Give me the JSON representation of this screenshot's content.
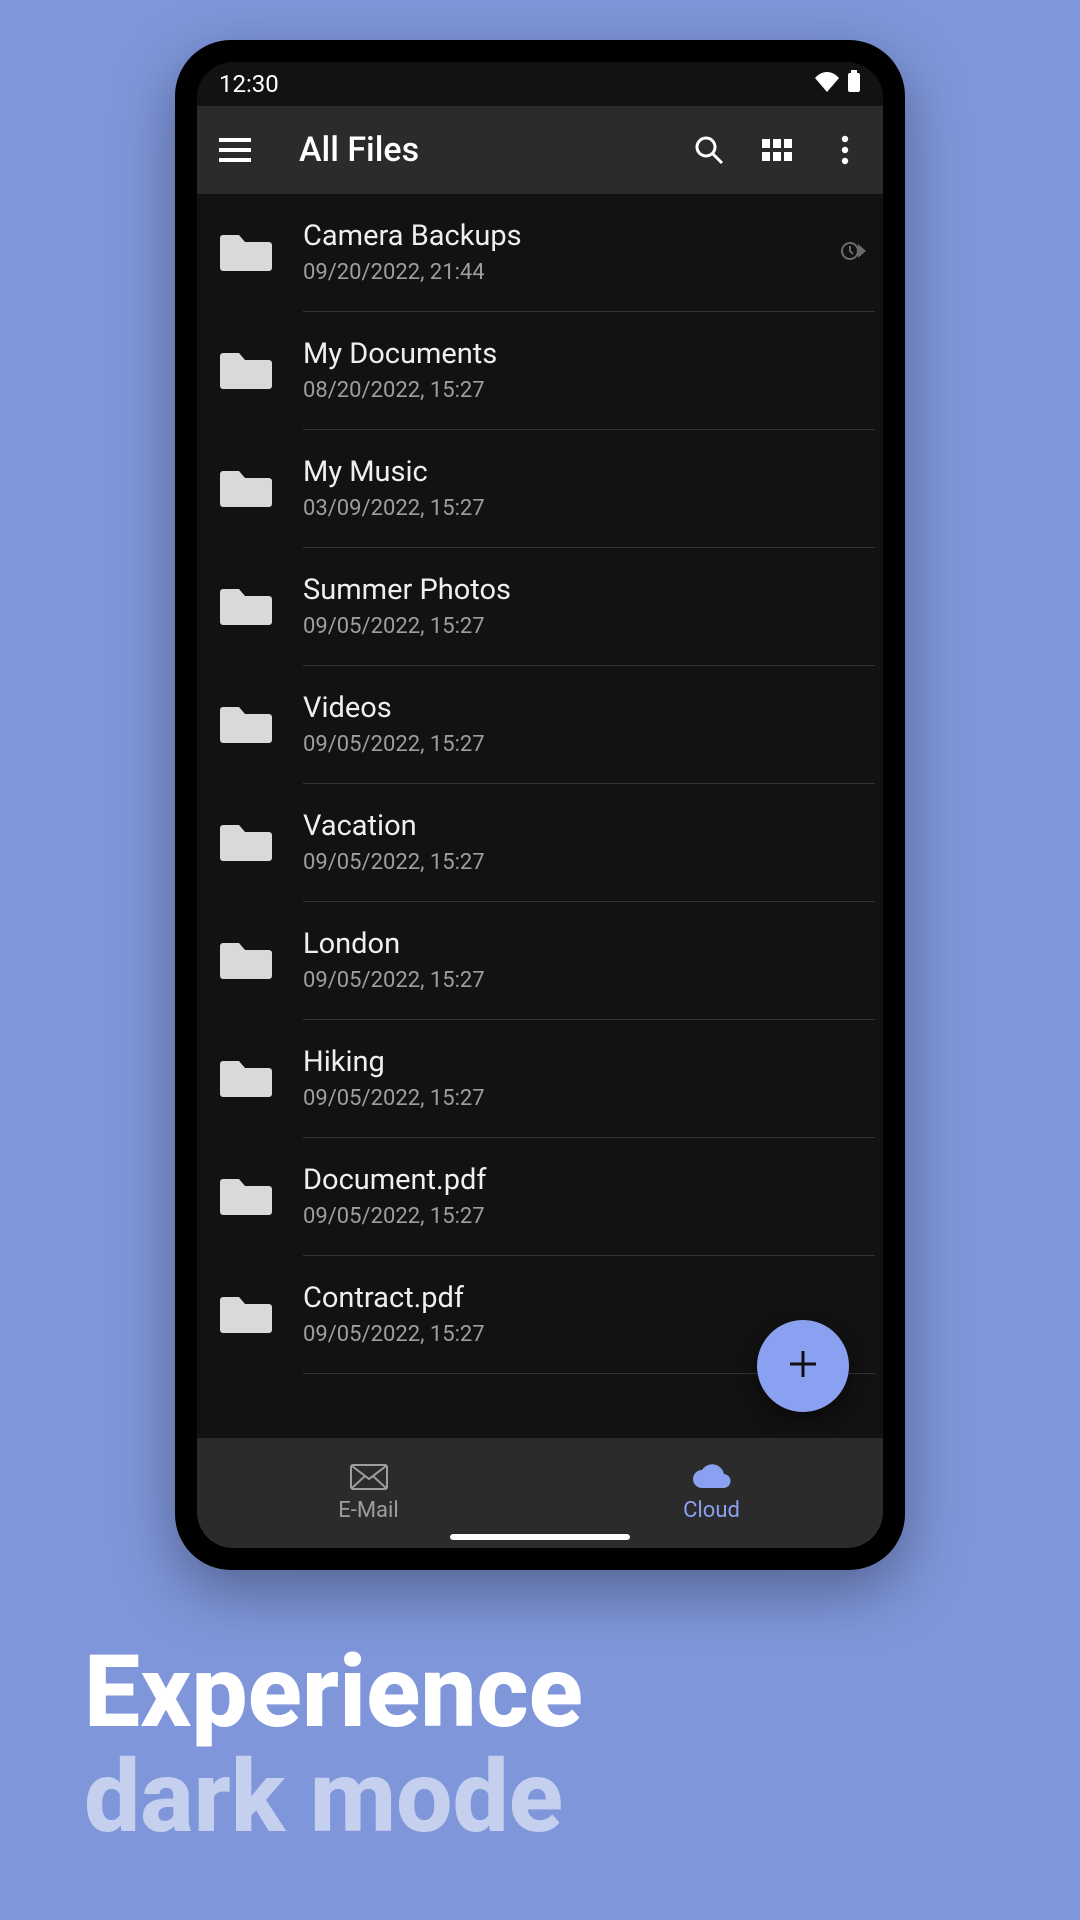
{
  "status": {
    "time": "12:30"
  },
  "toolbar": {
    "title": "All Files"
  },
  "files": [
    {
      "name": "Camera Backups",
      "date": "09/20/2022, 21:44",
      "badge": true
    },
    {
      "name": "My Documents",
      "date": "08/20/2022, 15:27"
    },
    {
      "name": "My Music",
      "date": "03/09/2022, 15:27"
    },
    {
      "name": "Summer Photos",
      "date": "09/05/2022, 15:27"
    },
    {
      "name": "Videos",
      "date": "09/05/2022, 15:27"
    },
    {
      "name": "Vacation",
      "date": "09/05/2022, 15:27"
    },
    {
      "name": "London",
      "date": "09/05/2022, 15:27"
    },
    {
      "name": "Hiking",
      "date": "09/05/2022, 15:27"
    },
    {
      "name": "Document.pdf",
      "date": "09/05/2022, 15:27"
    },
    {
      "name": "Contract.pdf",
      "date": "09/05/2022, 15:27"
    }
  ],
  "bottom": {
    "email": {
      "label": "E-Mail",
      "active": false
    },
    "cloud": {
      "label": "Cloud",
      "active": true
    }
  },
  "caption": {
    "line1": "Experience",
    "line2": "dark mode"
  },
  "colors": {
    "accent": "#8aa0f0",
    "bg": "#7f96da"
  }
}
